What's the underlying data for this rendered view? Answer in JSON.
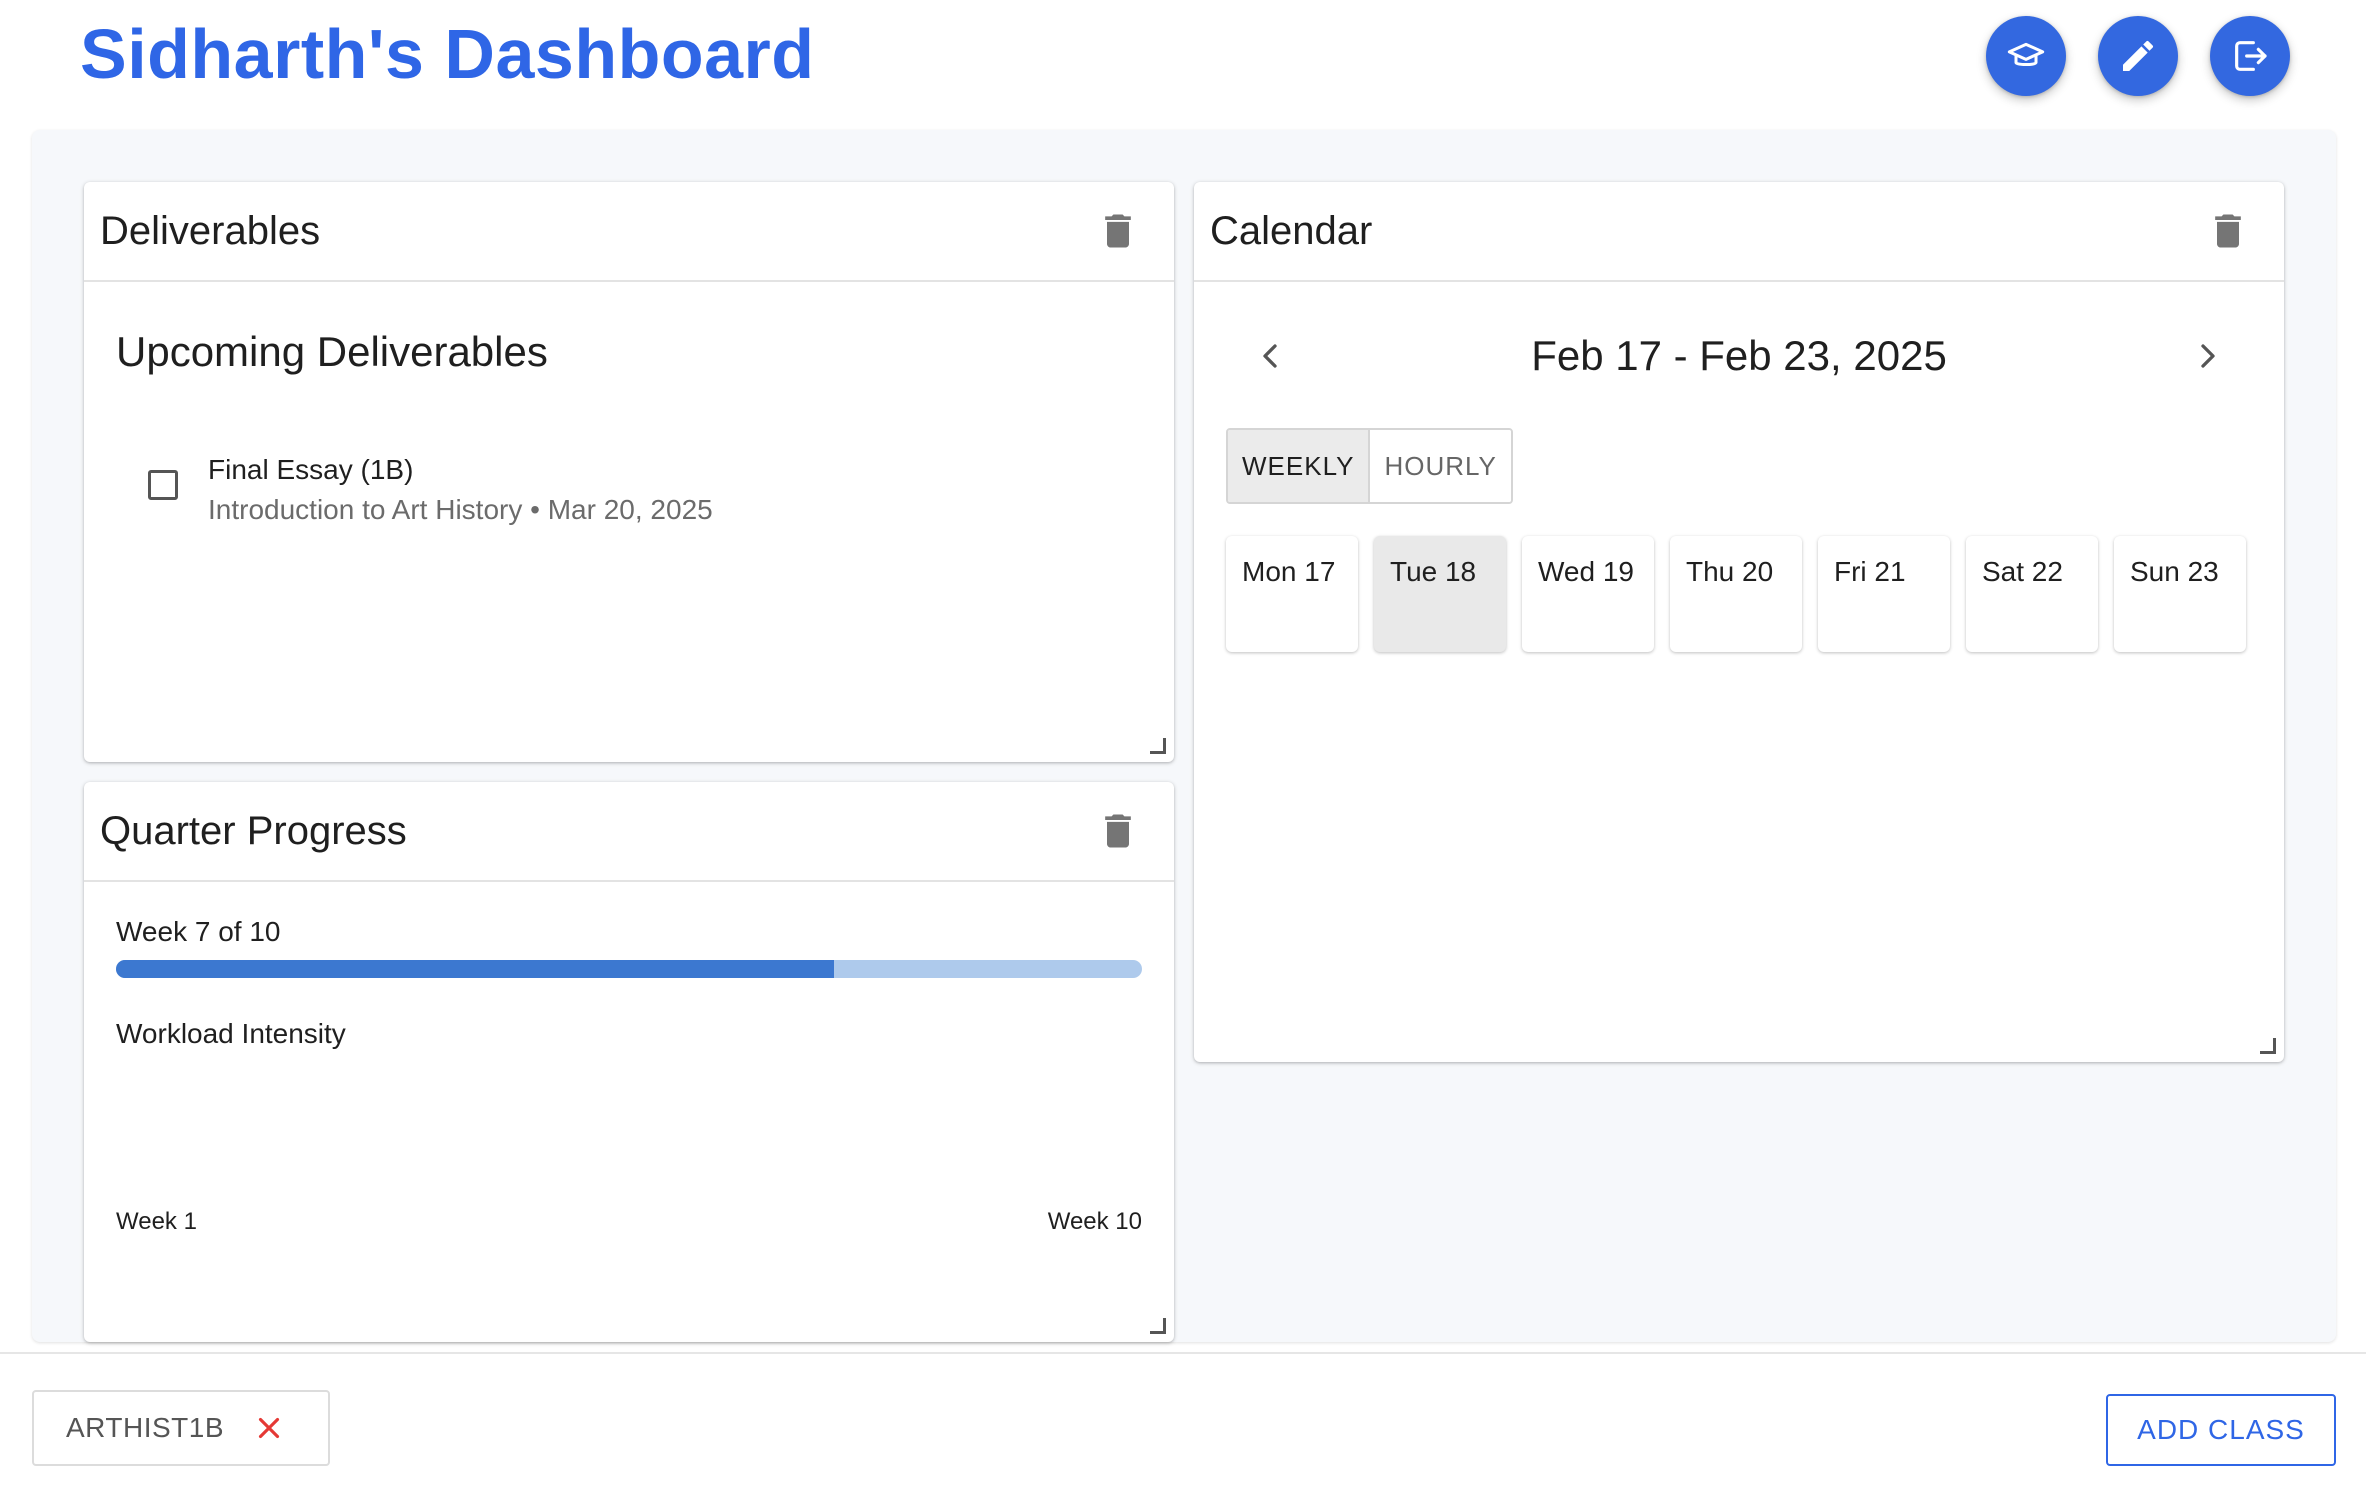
{
  "header": {
    "title": "Sidharth's Dashboard",
    "actions": [
      {
        "icon": "graduation-cap-icon"
      },
      {
        "icon": "pencil-icon"
      },
      {
        "icon": "logout-icon"
      }
    ]
  },
  "colors": {
    "brand": "#2f66e6",
    "fab": "#3368e0",
    "progress_fill": "#3c78d0",
    "progress_track": "#aecaec",
    "chip_close": "#e53935"
  },
  "deliverables": {
    "title": "Deliverables",
    "heading": "Upcoming Deliverables",
    "items": [
      {
        "name": "Final Essay (1B)",
        "subtitle": "Introduction to Art History • Mar 20, 2025",
        "checked": false
      }
    ]
  },
  "progress": {
    "title": "Quarter Progress",
    "week_label": "Week 7 of 10",
    "fraction": 0.7,
    "workload_label": "Workload Intensity",
    "start_label": "Week 1",
    "end_label": "Week 10"
  },
  "calendar": {
    "title": "Calendar",
    "range": "Feb 17 - Feb 23, 2025",
    "views": [
      "WEEKLY",
      "HOURLY"
    ],
    "active_view": "WEEKLY",
    "days": [
      "Mon 17",
      "Tue 18",
      "Wed 19",
      "Thu 20",
      "Fri 21",
      "Sat 22",
      "Sun 23"
    ],
    "selected_day": "Tue 18"
  },
  "footer": {
    "class_chip": "ARTHIST1B",
    "add_class_label": "ADD CLASS"
  }
}
